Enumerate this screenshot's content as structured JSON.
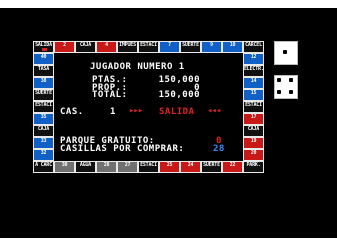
{
  "board": {
    "top": [
      {
        "label": "SALIDA",
        "color": "#101010",
        "num": "",
        "token": true
      },
      {
        "label": "2",
        "color": "#c81818"
      },
      {
        "label": "CAJA",
        "color": "#101010"
      },
      {
        "label": "4",
        "color": "#c81818"
      },
      {
        "label": "IMPUES",
        "color": "#101010"
      },
      {
        "label": "ESTACI",
        "color": "#101010"
      },
      {
        "label": "7",
        "color": "#1060c8"
      },
      {
        "label": "SUERTE",
        "color": "#101010"
      },
      {
        "label": "9",
        "color": "#1060c8"
      },
      {
        "label": "10",
        "color": "#1060c8"
      },
      {
        "label": "CARCEL",
        "color": "#101010"
      }
    ],
    "left": [
      {
        "label": "40",
        "color": "#1060c8"
      },
      {
        "label": "TASA",
        "color": "#101010"
      },
      {
        "label": "38",
        "color": "#1060c8"
      },
      {
        "label": "SUERTE",
        "color": "#101010"
      },
      {
        "label": "ESTACI",
        "color": "#101010"
      },
      {
        "label": "35",
        "color": "#1060c8"
      },
      {
        "label": "CAJA",
        "color": "#101010"
      },
      {
        "label": "33",
        "color": "#1060c8"
      },
      {
        "label": "32",
        "color": "#1060c8"
      }
    ],
    "right": [
      {
        "label": "12",
        "color": "#1060c8"
      },
      {
        "label": "ELECTR.",
        "color": "#101010"
      },
      {
        "label": "14",
        "color": "#1060c8"
      },
      {
        "label": "15",
        "color": "#1060c8"
      },
      {
        "label": "ESTACI",
        "color": "#101010"
      },
      {
        "label": "17",
        "color": "#c81818"
      },
      {
        "label": "CAJA",
        "color": "#101010"
      },
      {
        "label": "19",
        "color": "#c81818"
      },
      {
        "label": "20",
        "color": "#c81818"
      }
    ],
    "bottom": [
      {
        "label": "A CARC",
        "color": "#101010"
      },
      {
        "label": "30",
        "color": "#707070"
      },
      {
        "label": "AGUA",
        "color": "#101010"
      },
      {
        "label": "28",
        "color": "#707070"
      },
      {
        "label": "27",
        "color": "#707070"
      },
      {
        "label": "ESTACI",
        "color": "#101010"
      },
      {
        "label": "25",
        "color": "#c81818"
      },
      {
        "label": "24",
        "color": "#c81818"
      },
      {
        "label": "SUERTE",
        "color": "#101010"
      },
      {
        "label": "22",
        "color": "#c81818"
      },
      {
        "label": "PARK.",
        "color": "#101010"
      }
    ]
  },
  "panel": {
    "title": "JUGADOR NUMERO 1",
    "ptas_label": "PTAS.:",
    "ptas_value": "150,000",
    "prop_label": "PROP.:",
    "prop_value": "0",
    "total_label": "TOTAL:",
    "total_value": "150,000",
    "cas_label": "CAS.",
    "cas_value": "1",
    "salida_arrows_left": "▸▸▸",
    "salida_text": "SALIDA",
    "salida_arrows_right": "◂◂◂",
    "parque_label": "PARQUE GRATUITO:",
    "parque_value": "0",
    "casillas_label": "CASILLAS POR COMPRAR:",
    "casillas_value": "28"
  },
  "dice": [
    {
      "value": 1,
      "name": "die-one"
    },
    {
      "value": 4,
      "name": "die-two"
    }
  ],
  "colors": {
    "text": "#ffffff",
    "red": "#e02020",
    "blue": "#3a8cff",
    "background": "#000000"
  }
}
